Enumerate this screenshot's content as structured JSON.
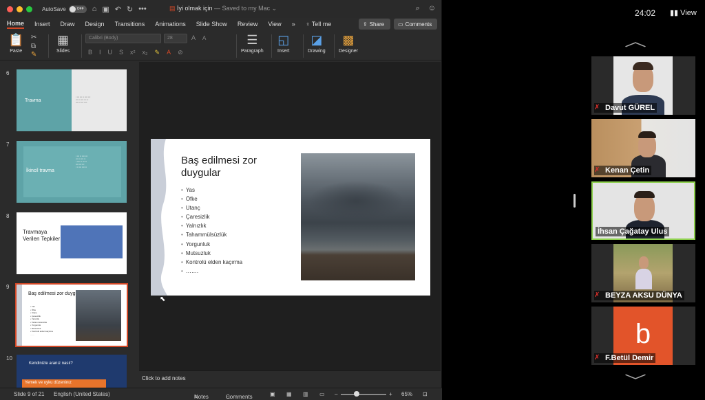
{
  "titlebar": {
    "autosave_label": "AutoSave",
    "autosave_state": "OFF",
    "doc_name": "İyi olmak için",
    "save_status": " — Saved to my Mac ⌄",
    "more": "•••"
  },
  "tabs": [
    "Home",
    "Insert",
    "Draw",
    "Design",
    "Transitions",
    "Animations",
    "Slide Show",
    "Review",
    "View"
  ],
  "tabs_more": "»",
  "tell_me": "Tell me",
  "share_label": "Share",
  "comments_label": "Comments",
  "ribbon": {
    "paste": "Paste",
    "slides": "Slides",
    "font_name": "Calibri (Body)",
    "font_size": "28",
    "paragraph": "Paragraph",
    "insert": "Insert",
    "drawing": "Drawing",
    "designer": "Designer"
  },
  "thumbnails": {
    "numbers": [
      "6",
      "7",
      "8",
      "9",
      "10"
    ],
    "t6_title": "Travma",
    "t7_title": "İkincil travma",
    "t8_title": "Travmaya Verilen Tepkiler",
    "t9_title": "Baş edilmesi zor duygular",
    "t10_title": "Kendinizle aranız nasıl?",
    "t10_orange": "Yemek ve uyku düzeninız"
  },
  "slide": {
    "title": "Baş edilmesi zor duygular",
    "bullets": [
      "Yas",
      "Öfke",
      "Utanç",
      "Çaresizlik",
      "Yalnızlık",
      "Tahammülsüzlük",
      "Yorgunluk",
      "Mutsuzluk",
      "Kontrolü elden kaçırma"
    ],
    "ellipsis": "……."
  },
  "notes_placeholder": "Click to add notes",
  "status": {
    "slide_count": "Slide 9 of 21",
    "language": "English (United States)",
    "notes": "Notes",
    "comments": "Comments",
    "zoom": "65%"
  },
  "zoom_meeting": {
    "timer": "24:02",
    "view": "View",
    "participants": [
      {
        "name": "Davut GÜREL",
        "muted": true,
        "speaking": false
      },
      {
        "name": "Kenan Çetin",
        "muted": true,
        "speaking": false
      },
      {
        "name": "İhsan Çağatay Ulus",
        "muted": false,
        "speaking": true
      },
      {
        "name": "BEYZA AKSU DÜNYA",
        "muted": true,
        "speaking": false
      },
      {
        "name": "F.Betül Demir",
        "muted": true,
        "speaking": false
      }
    ],
    "avatar_letter": "b",
    "avatar_color": "#e2542a"
  },
  "colors": {
    "accent_ppt": "#d24726",
    "active_speaker": "#8fd14f",
    "mute_red": "#e0302b"
  }
}
